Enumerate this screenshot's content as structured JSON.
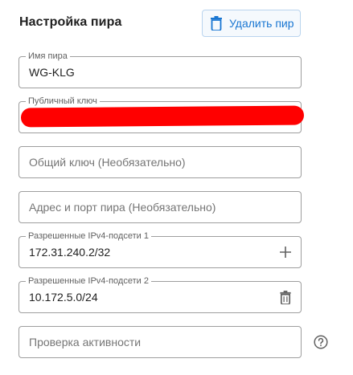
{
  "header": {
    "title": "Настройка пира",
    "delete_button_label": "Удалить пир"
  },
  "fields": {
    "peer_name": {
      "label": "Имя пира",
      "value": "WG-KLG"
    },
    "public_key": {
      "label": "Публичный ключ",
      "value_redacted": true
    },
    "preshared_key": {
      "placeholder": "Общий ключ (Необязательно)"
    },
    "endpoint": {
      "placeholder": "Адрес и порт пира (Необязательно)"
    },
    "allowed_ips_1": {
      "label": "Разрешенные IPv4-подсети 1",
      "value": "172.31.240.2/32",
      "action_icon": "plus-icon"
    },
    "allowed_ips_2": {
      "label": "Разрешенные IPv4-подсети 2",
      "value": "10.172.5.0/24",
      "action_icon": "trash-icon"
    },
    "keepalive": {
      "placeholder": "Проверка активности",
      "help_icon": "help-circle-icon"
    }
  },
  "colors": {
    "accent": "#1976d2",
    "border": "#9e9e9e",
    "redaction": "#ff0000"
  }
}
